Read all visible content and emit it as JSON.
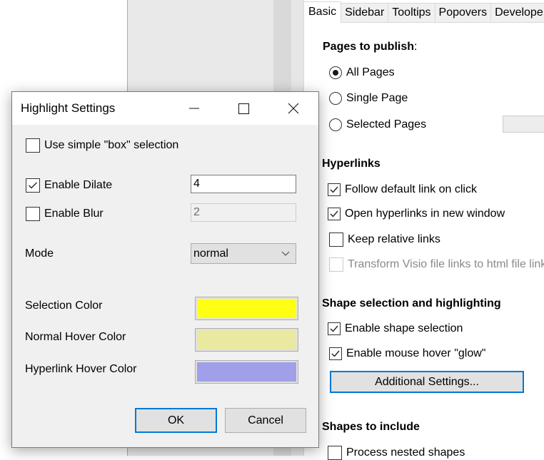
{
  "background_app": {
    "tabs": [
      {
        "label": "Basic",
        "active": true
      },
      {
        "label": "Sidebar",
        "active": false
      },
      {
        "label": "Tooltips",
        "active": false
      },
      {
        "label": "Popovers",
        "active": false
      },
      {
        "label": "Develope",
        "active": false
      }
    ],
    "pages_to_publish": {
      "heading": "Pages to publish",
      "heading_suffix": ":",
      "options": [
        {
          "label": "All Pages",
          "selected": true
        },
        {
          "label": "Single Page",
          "selected": false
        },
        {
          "label": "Selected Pages",
          "selected": false
        }
      ],
      "selected_pages_value": ""
    },
    "hyperlinks": {
      "heading": "Hyperlinks",
      "options": [
        {
          "label": "Follow default link on click",
          "checked": true,
          "enabled": true
        },
        {
          "label": "Open hyperlinks in new window",
          "checked": true,
          "enabled": true
        },
        {
          "label": "Keep relative links",
          "checked": false,
          "enabled": true
        },
        {
          "label": "Transform Visio file links to html file links",
          "checked": false,
          "enabled": false
        }
      ]
    },
    "shape_selection": {
      "heading": "Shape selection and highlighting",
      "options": [
        {
          "label": "Enable shape selection",
          "checked": true
        },
        {
          "label": "Enable mouse hover \"glow\"",
          "checked": true
        }
      ],
      "additional_settings_label": "Additional Settings..."
    },
    "shapes_to_include": {
      "heading": "Shapes to include",
      "options": [
        {
          "label": "Process nested shapes",
          "checked": false
        }
      ]
    }
  },
  "dialog": {
    "title": "Highlight Settings",
    "use_box_selection": {
      "label": "Use simple \"box\" selection",
      "checked": false
    },
    "enable_dilate": {
      "label": "Enable Dilate",
      "checked": true,
      "value": "4"
    },
    "enable_blur": {
      "label": "Enable Blur",
      "checked": false,
      "value": "2"
    },
    "mode": {
      "label": "Mode",
      "value": "normal"
    },
    "colors": [
      {
        "label": "Selection Color",
        "color": "#ffff14"
      },
      {
        "label": "Normal Hover Color",
        "color": "#e9e9a1"
      },
      {
        "label": "Hyperlink Hover Color",
        "color": "#a09fe8"
      }
    ],
    "ok_label": "OK",
    "cancel_label": "Cancel"
  }
}
